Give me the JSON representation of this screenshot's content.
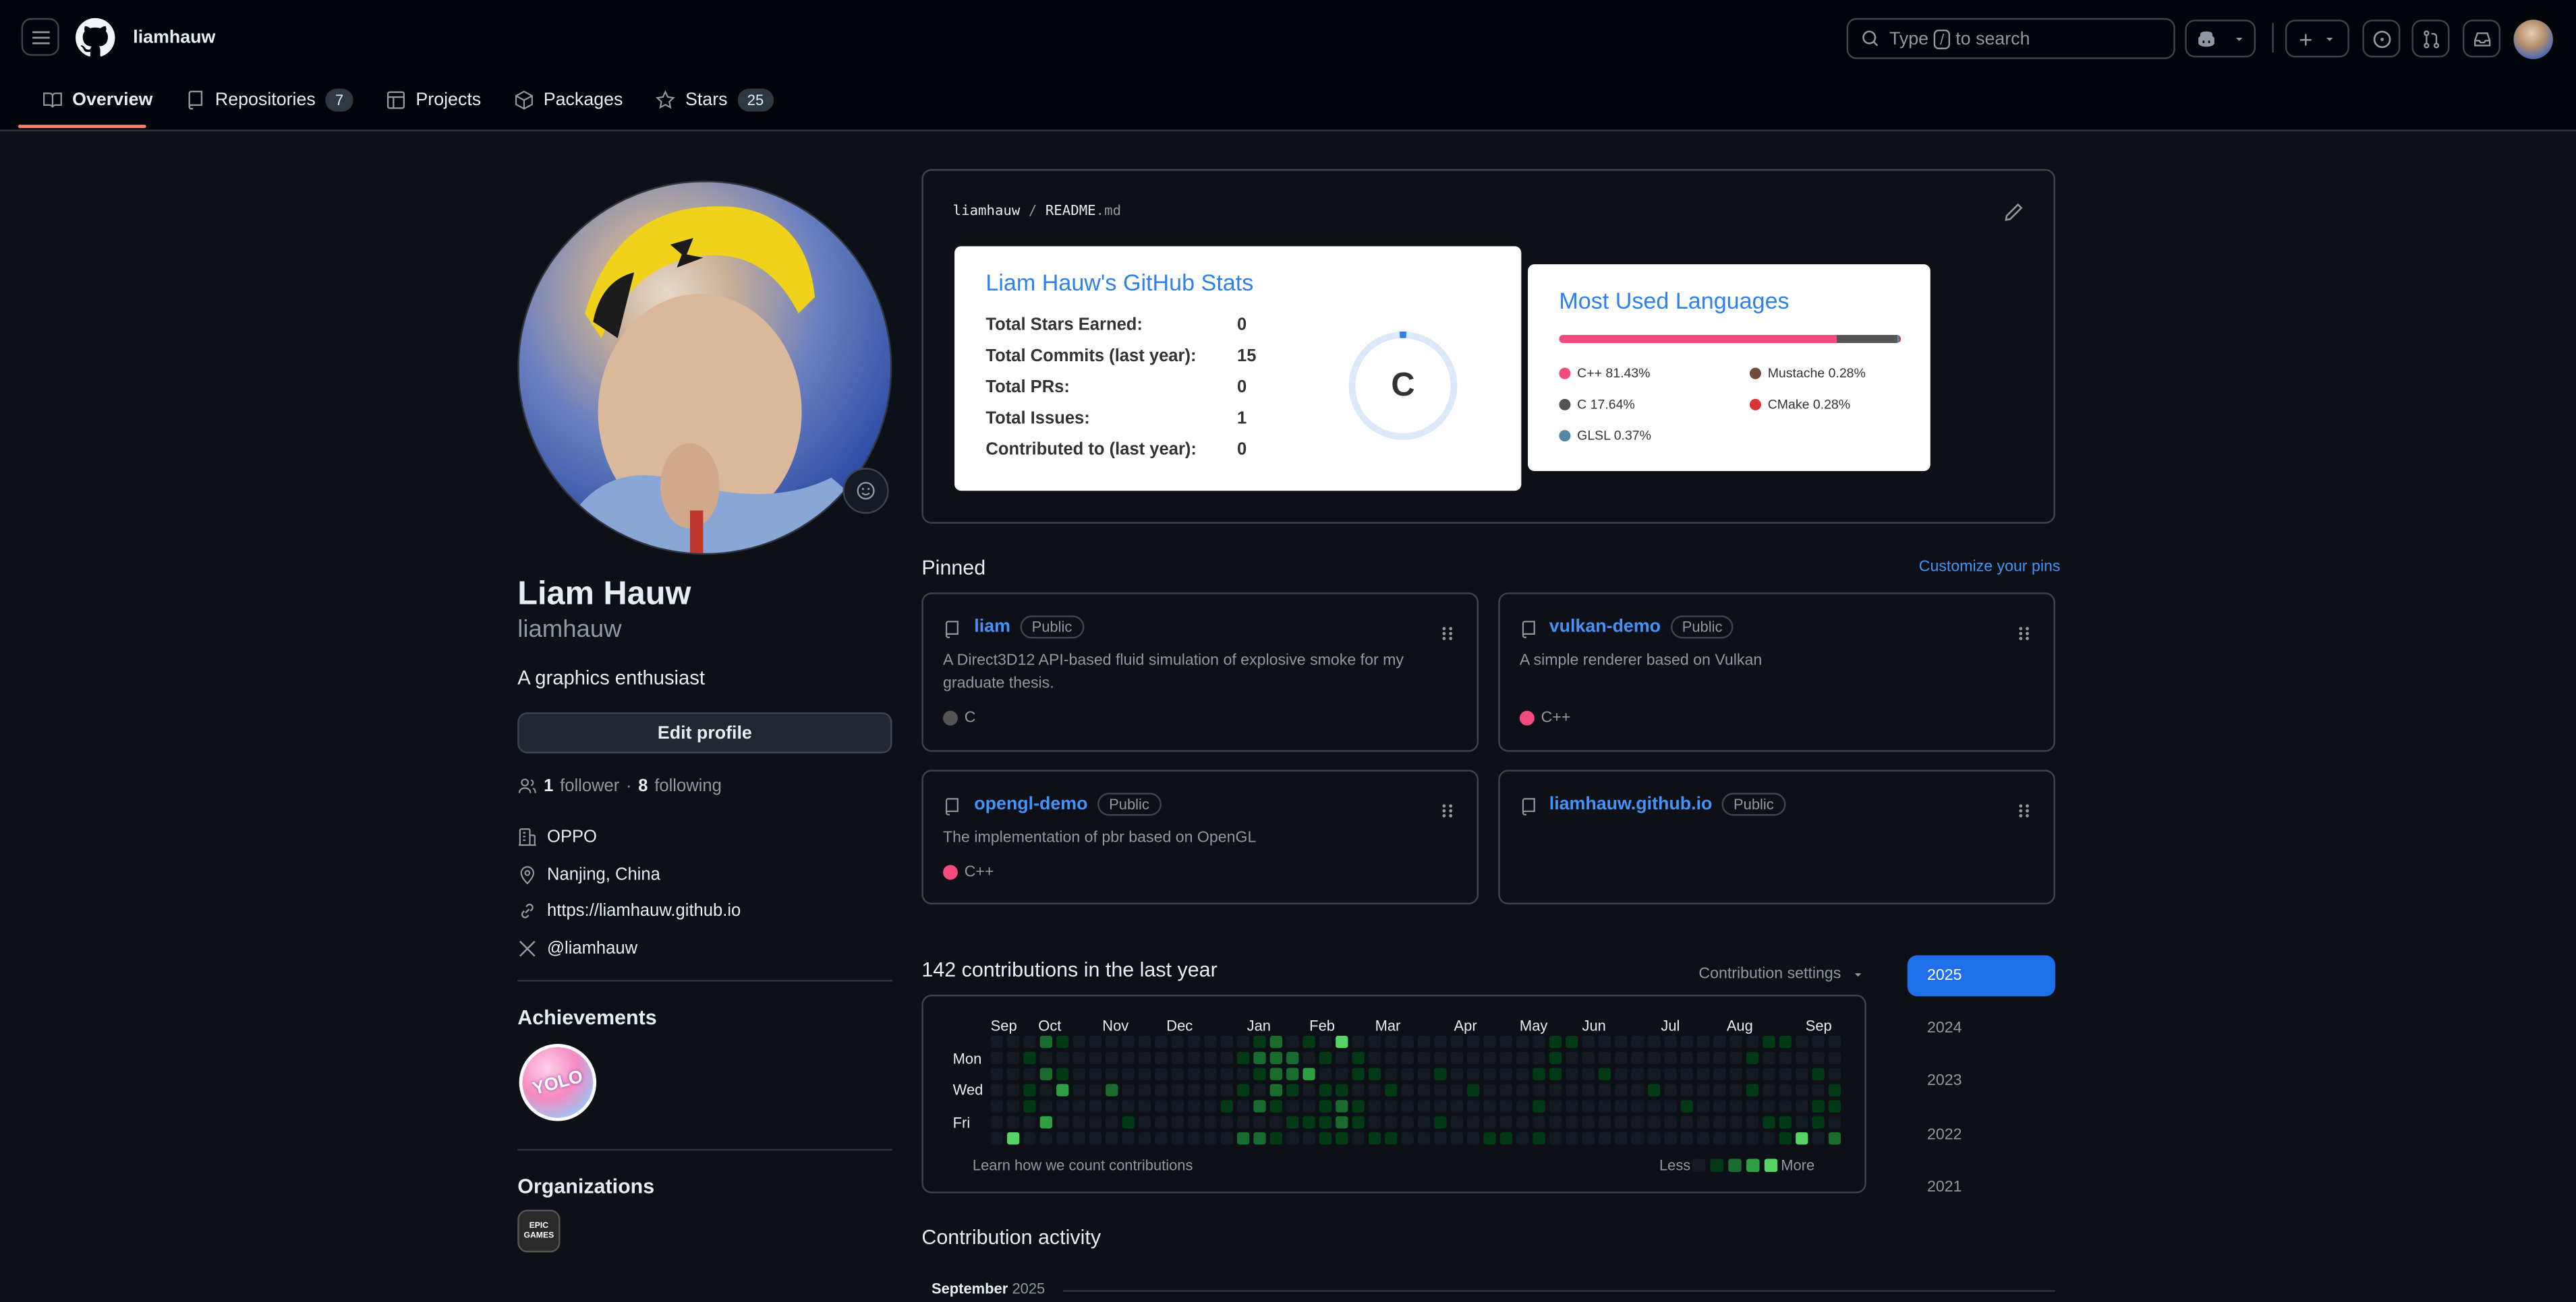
{
  "header": {
    "username": "liamhauw",
    "search_prefix": "Type",
    "search_key": "/",
    "search_suffix": "to search",
    "plus_label": "+"
  },
  "tabs": [
    {
      "label": "Overview",
      "icon": "book-icon"
    },
    {
      "label": "Repositories",
      "count": "7",
      "icon": "repo-icon"
    },
    {
      "label": "Projects",
      "icon": "table-icon"
    },
    {
      "label": "Packages",
      "icon": "package-icon"
    },
    {
      "label": "Stars",
      "count": "25",
      "icon": "star-icon"
    }
  ],
  "profile": {
    "name": "Liam Hauw",
    "login": "liamhauw",
    "bio": "A graphics enthusiast",
    "edit_label": "Edit profile",
    "followers": "1",
    "followers_label": "follower",
    "sep": "·",
    "following": "8",
    "following_label": "following",
    "company": "OPPO",
    "location": "Nanjing, China",
    "website": "https://liamhauw.github.io",
    "twitter": "@liamhauw"
  },
  "achievements": {
    "title": "Achievements",
    "badge_text": "YOLO"
  },
  "organizations": {
    "title": "Organizations",
    "org_logo_text": "EPIC GAMES"
  },
  "readme": {
    "path_user": "liamhauw",
    "path_sep": "/",
    "path_file": "README",
    "path_ext": ".md"
  },
  "stats_card": {
    "title": "Liam Hauw's GitHub Stats",
    "rows": [
      {
        "label": "Total Stars Earned:",
        "value": "0"
      },
      {
        "label": "Total Commits (last year):",
        "value": "15"
      },
      {
        "label": "Total PRs:",
        "value": "0"
      },
      {
        "label": "Total Issues:",
        "value": "1"
      },
      {
        "label": "Contributed to (last year):",
        "value": "0"
      }
    ],
    "grade": "C"
  },
  "lang_card": {
    "title": "Most Used Languages",
    "langs": [
      {
        "name": "C++ 81.43%",
        "color": "#f34b7d",
        "pct": 81.43
      },
      {
        "name": "Mustache 0.28%",
        "color": "#724b3b",
        "pct": 0.28
      },
      {
        "name": "C 17.64%",
        "color": "#555555",
        "pct": 17.64
      },
      {
        "name": "CMake 0.28%",
        "color": "#da3434",
        "pct": 0.28
      },
      {
        "name": "GLSL 0.37%",
        "color": "#5686a5",
        "pct": 0.37
      }
    ]
  },
  "pinned": {
    "title": "Pinned",
    "customize": "Customize your pins",
    "items": [
      {
        "name": "liam",
        "visibility": "Public",
        "desc": "A Direct3D12 API-based fluid simulation of explosive smoke for my graduate thesis.",
        "lang": "C",
        "lang_color": "#555555"
      },
      {
        "name": "vulkan-demo",
        "visibility": "Public",
        "desc": "A simple renderer based on Vulkan",
        "lang": "C++",
        "lang_color": "#f34b7d"
      },
      {
        "name": "opengl-demo",
        "visibility": "Public",
        "desc": "The implementation of pbr based on OpenGL",
        "lang": "C++",
        "lang_color": "#f34b7d"
      },
      {
        "name": "liamhauw.github.io",
        "visibility": "Public",
        "desc": "",
        "lang": "",
        "lang_color": ""
      }
    ]
  },
  "contributions": {
    "title": "142 contributions in the last year",
    "settings": "Contribution settings",
    "months": [
      "Sep",
      "Oct",
      "Nov",
      "Dec",
      "Jan",
      "Feb",
      "Mar",
      "Apr",
      "May",
      "Jun",
      "Jul",
      "Aug",
      "Sep"
    ],
    "days": [
      "Mon",
      "Wed",
      "Fri"
    ],
    "learn": "Learn how we count contributions",
    "less": "Less",
    "more": "More",
    "years": [
      "2025",
      "2024",
      "2023",
      "2022",
      "2021"
    ],
    "selected_year": "2025"
  },
  "activity": {
    "title": "Contribution activity",
    "month": "September",
    "year": "2025"
  }
}
